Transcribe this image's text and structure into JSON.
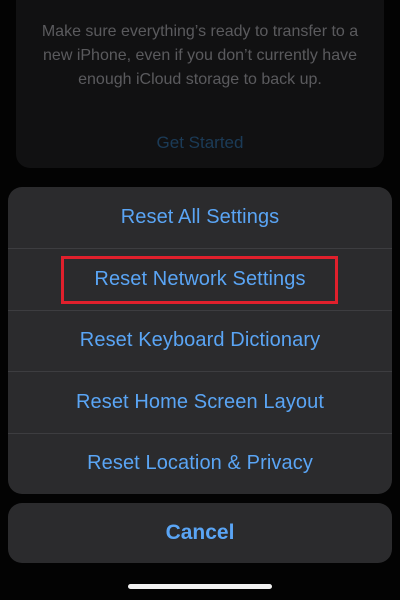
{
  "background_card": {
    "description": "Make sure everything’s ready to transfer to a new iPhone, even if you don’t currently have enough iCloud storage to back up.",
    "link_label": "Get Started"
  },
  "action_sheet": {
    "items": [
      {
        "label": "Reset All Settings"
      },
      {
        "label": "Reset Network Settings",
        "highlighted": true
      },
      {
        "label": "Reset Keyboard Dictionary"
      },
      {
        "label": "Reset Home Screen Layout"
      },
      {
        "label": "Reset Location & Privacy"
      }
    ],
    "cancel_label": "Cancel"
  },
  "colors": {
    "accent": "#5aa5f5",
    "highlight": "#e0202c",
    "sheet_background": "#2b2b2d"
  }
}
